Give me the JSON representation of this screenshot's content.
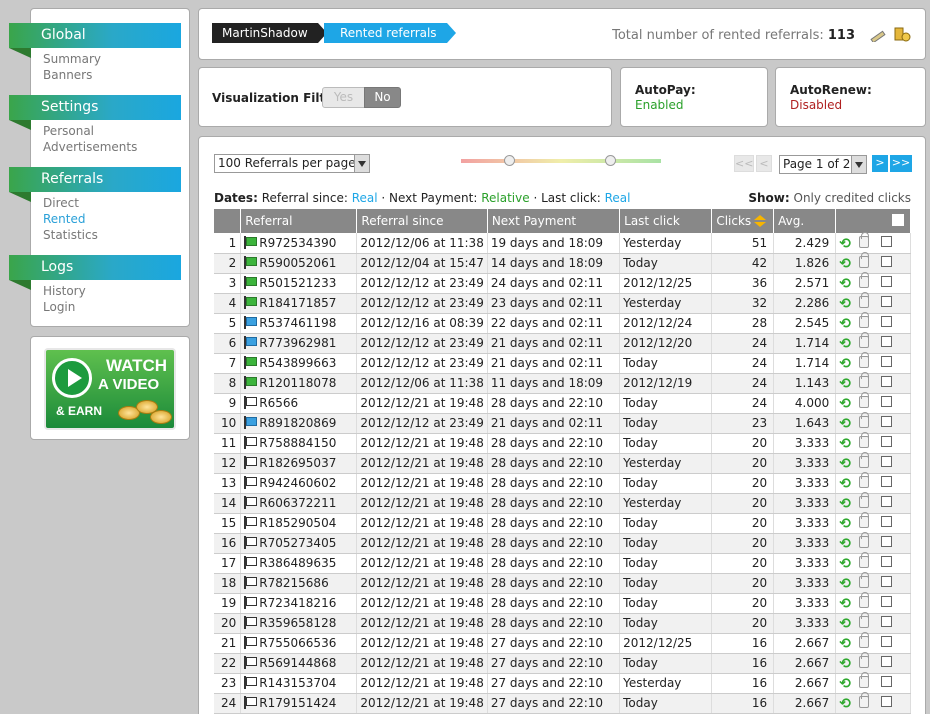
{
  "sidebar": {
    "sections": [
      {
        "title": "Global",
        "items": [
          {
            "label": "Summary",
            "active": false
          },
          {
            "label": "Banners",
            "active": false
          }
        ]
      },
      {
        "title": "Settings",
        "items": [
          {
            "label": "Personal",
            "active": false
          },
          {
            "label": "Advertisements",
            "active": false
          }
        ]
      },
      {
        "title": "Referrals",
        "items": [
          {
            "label": "Direct",
            "active": false
          },
          {
            "label": "Rented",
            "active": true
          },
          {
            "label": "Statistics",
            "active": false
          }
        ]
      },
      {
        "title": "Logs",
        "items": [
          {
            "label": "History",
            "active": false
          },
          {
            "label": "Login",
            "active": false
          }
        ]
      }
    ]
  },
  "ad": {
    "line1": "WATCH",
    "line2": "A VIDEO",
    "line3": "& EARN"
  },
  "header": {
    "breadcrumb_user": "MartinShadow",
    "breadcrumb_page": "Rented referrals",
    "total_label": "Total number of rented referrals:",
    "total_value": "113"
  },
  "filter": {
    "label": "Visualization Filter:",
    "yes": "Yes",
    "no": "No",
    "selected": "No"
  },
  "autopay": {
    "label": "AutoPay:",
    "value": "Enabled",
    "color": "#2aa02a"
  },
  "autorenew": {
    "label": "AutoRenew:",
    "value": "Disabled",
    "color": "#b02020"
  },
  "controls": {
    "per_page": "100 Referrals per page",
    "page_select": "Page 1 of 2",
    "first": "<<",
    "prev": "<",
    "next": ">",
    "last": ">>"
  },
  "dates": {
    "label": "Dates:",
    "since_label": "Referral since:",
    "since_value": "Real",
    "next_label": "Next Payment:",
    "next_value": "Relative",
    "last_label": "Last click:",
    "last_value": "Real"
  },
  "show": {
    "label": "Show:",
    "value": "Only credited clicks"
  },
  "table": {
    "headers": [
      "",
      "Referral",
      "Referral since",
      "Next Payment",
      "Last click",
      "Clicks",
      "Avg.",
      ""
    ],
    "rows": [
      {
        "n": "1",
        "flag": "green",
        "id": "R972534390",
        "since": "2012/12/06 at 11:38",
        "next": "19 days and 18:09",
        "last": "Yesterday",
        "clicks": "51",
        "avg": "2.429"
      },
      {
        "n": "2",
        "flag": "green",
        "id": "R590052061",
        "since": "2012/12/04 at 15:47",
        "next": "14 days and 18:09",
        "last": "Today",
        "clicks": "42",
        "avg": "1.826"
      },
      {
        "n": "3",
        "flag": "green",
        "id": "R501521233",
        "since": "2012/12/12 at 23:49",
        "next": "24 days and 02:11",
        "last": "2012/12/25",
        "clicks": "36",
        "avg": "2.571"
      },
      {
        "n": "4",
        "flag": "green",
        "id": "R184171857",
        "since": "2012/12/12 at 23:49",
        "next": "23 days and 02:11",
        "last": "Yesterday",
        "clicks": "32",
        "avg": "2.286"
      },
      {
        "n": "5",
        "flag": "blue",
        "id": "R537461198",
        "since": "2012/12/16 at 08:39",
        "next": "22 days and 02:11",
        "last": "2012/12/24",
        "clicks": "28",
        "avg": "2.545"
      },
      {
        "n": "6",
        "flag": "blue",
        "id": "R773962981",
        "since": "2012/12/12 at 23:49",
        "next": "21 days and 02:11",
        "last": "2012/12/20",
        "clicks": "24",
        "avg": "1.714"
      },
      {
        "n": "7",
        "flag": "green",
        "id": "R543899663",
        "since": "2012/12/12 at 23:49",
        "next": "21 days and 02:11",
        "last": "Today",
        "clicks": "24",
        "avg": "1.714"
      },
      {
        "n": "8",
        "flag": "green",
        "id": "R120118078",
        "since": "2012/12/06 at 11:38",
        "next": "11 days and 18:09",
        "last": "2012/12/19",
        "clicks": "24",
        "avg": "1.143"
      },
      {
        "n": "9",
        "flag": "white",
        "id": "R6566",
        "since": "2012/12/21 at 19:48",
        "next": "28 days and 22:10",
        "last": "Today",
        "clicks": "24",
        "avg": "4.000"
      },
      {
        "n": "10",
        "flag": "blue",
        "id": "R891820869",
        "since": "2012/12/12 at 23:49",
        "next": "21 days and 02:11",
        "last": "Today",
        "clicks": "23",
        "avg": "1.643"
      },
      {
        "n": "11",
        "flag": "white",
        "id": "R758884150",
        "since": "2012/12/21 at 19:48",
        "next": "28 days and 22:10",
        "last": "Today",
        "clicks": "20",
        "avg": "3.333"
      },
      {
        "n": "12",
        "flag": "white",
        "id": "R182695037",
        "since": "2012/12/21 at 19:48",
        "next": "28 days and 22:10",
        "last": "Yesterday",
        "clicks": "20",
        "avg": "3.333"
      },
      {
        "n": "13",
        "flag": "white",
        "id": "R942460602",
        "since": "2012/12/21 at 19:48",
        "next": "28 days and 22:10",
        "last": "Today",
        "clicks": "20",
        "avg": "3.333"
      },
      {
        "n": "14",
        "flag": "white",
        "id": "R606372211",
        "since": "2012/12/21 at 19:48",
        "next": "28 days and 22:10",
        "last": "Yesterday",
        "clicks": "20",
        "avg": "3.333"
      },
      {
        "n": "15",
        "flag": "white",
        "id": "R185290504",
        "since": "2012/12/21 at 19:48",
        "next": "28 days and 22:10",
        "last": "Today",
        "clicks": "20",
        "avg": "3.333"
      },
      {
        "n": "16",
        "flag": "white",
        "id": "R705273405",
        "since": "2012/12/21 at 19:48",
        "next": "28 days and 22:10",
        "last": "Today",
        "clicks": "20",
        "avg": "3.333"
      },
      {
        "n": "17",
        "flag": "white",
        "id": "R386489635",
        "since": "2012/12/21 at 19:48",
        "next": "28 days and 22:10",
        "last": "Today",
        "clicks": "20",
        "avg": "3.333"
      },
      {
        "n": "18",
        "flag": "white",
        "id": "R78215686",
        "since": "2012/12/21 at 19:48",
        "next": "28 days and 22:10",
        "last": "Today",
        "clicks": "20",
        "avg": "3.333"
      },
      {
        "n": "19",
        "flag": "white",
        "id": "R723418216",
        "since": "2012/12/21 at 19:48",
        "next": "28 days and 22:10",
        "last": "Today",
        "clicks": "20",
        "avg": "3.333"
      },
      {
        "n": "20",
        "flag": "white",
        "id": "R359658128",
        "since": "2012/12/21 at 19:48",
        "next": "28 days and 22:10",
        "last": "Today",
        "clicks": "20",
        "avg": "3.333"
      },
      {
        "n": "21",
        "flag": "white",
        "id": "R755066536",
        "since": "2012/12/21 at 19:48",
        "next": "27 days and 22:10",
        "last": "2012/12/25",
        "clicks": "16",
        "avg": "2.667"
      },
      {
        "n": "22",
        "flag": "white",
        "id": "R569144868",
        "since": "2012/12/21 at 19:48",
        "next": "27 days and 22:10",
        "last": "Today",
        "clicks": "16",
        "avg": "2.667"
      },
      {
        "n": "23",
        "flag": "white",
        "id": "R143153704",
        "since": "2012/12/21 at 19:48",
        "next": "27 days and 22:10",
        "last": "Yesterday",
        "clicks": "16",
        "avg": "2.667"
      },
      {
        "n": "24",
        "flag": "white",
        "id": "R179151424",
        "since": "2012/12/21 at 19:48",
        "next": "27 days and 22:10",
        "last": "Today",
        "clicks": "16",
        "avg": "2.667"
      }
    ]
  }
}
